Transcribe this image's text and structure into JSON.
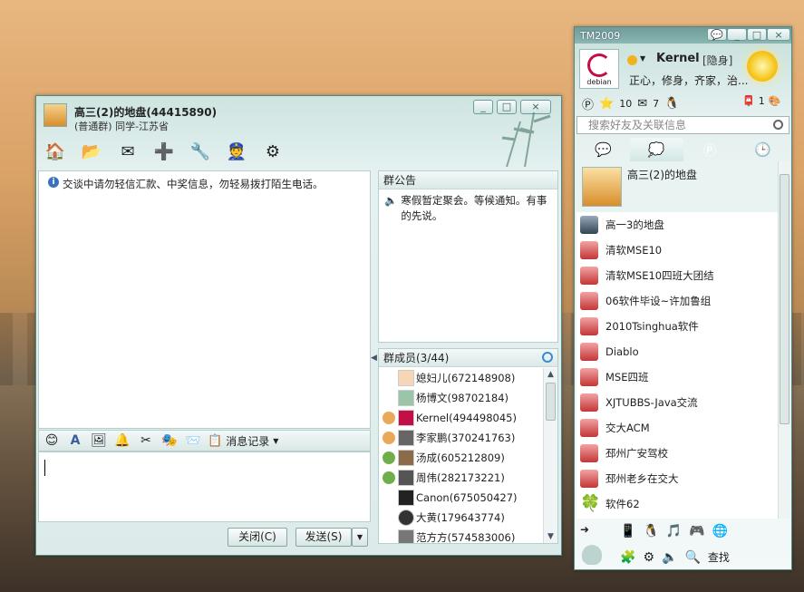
{
  "chat": {
    "title": "高三(2)的地盘(44415890)",
    "subtitle": "(普通群) 同学-江苏省",
    "minimize": "_",
    "maximize": "□",
    "close": "×",
    "toolbar_icons": [
      "home-icon",
      "folder-icon",
      "mail-icon",
      "add-app-icon",
      "tools-icon",
      "police-icon",
      "settings-icon"
    ],
    "notice_text": "交谈中请勿轻信汇款、中奖信息，勿轻易拨打陌生电话。",
    "bulletin": {
      "heading": "群公告",
      "text": "寒假暂定聚会。等候通知。有事的先说。"
    },
    "members": {
      "heading": "群成员(3/44)",
      "list": [
        {
          "name": "媳妇儿(672148908)"
        },
        {
          "name": "杨博文(98702184)"
        },
        {
          "name": "Kernel(494498045)"
        },
        {
          "name": "李家鹏(370241763)"
        },
        {
          "name": "汤成(605212809)"
        },
        {
          "name": "周伟(282173221)"
        },
        {
          "name": "Canon(675050427)"
        },
        {
          "name": "大黄(179643774)"
        },
        {
          "name": "范方方(574583006)"
        }
      ]
    },
    "input_toolbar": {
      "history_label": "消息记录"
    },
    "close_button": "关闭(C)",
    "send_button": "发送(S)"
  },
  "tm": {
    "app_title": "TM2009",
    "logo_text": "debian",
    "nickname": "Kernel",
    "status": "[隐身]",
    "signature": "正心，修身，齐家，治...",
    "counts": {
      "star": "10",
      "mail": "7",
      "notify": "1"
    },
    "search_placeholder": "搜索好友及关联信息",
    "featured_group": "高三(2)的地盘",
    "groups": [
      "高一3的地盘",
      "清软MSE10",
      "清软MSE10四班大团结",
      "06软件毕设~许加鲁组",
      "2010Tsinghua软件",
      "Diablo",
      "MSE四班",
      "XJTUBBS-Java交流",
      "交大ACM",
      "邳州广安驾校",
      "邳州老乡在交大",
      "软件62"
    ],
    "find_label": "查找"
  }
}
